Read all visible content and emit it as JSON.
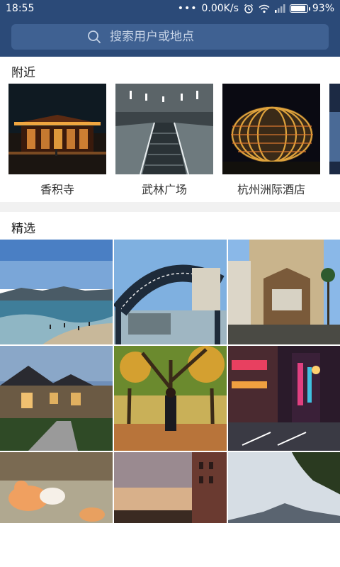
{
  "status_bar": {
    "time": "18:55",
    "network_speed": "0.00K/s",
    "battery_percent": "93%",
    "battery_level": 0.93
  },
  "search": {
    "placeholder": "搜索用户或地点"
  },
  "nearby": {
    "title": "附近",
    "items": [
      {
        "label": "香积寺"
      },
      {
        "label": "武林广场"
      },
      {
        "label": "杭州洲际酒店"
      },
      {
        "label": ""
      }
    ]
  },
  "featured": {
    "title": "精选"
  },
  "colors": {
    "header": "#2b4a78",
    "search_box": "#3f6192"
  }
}
